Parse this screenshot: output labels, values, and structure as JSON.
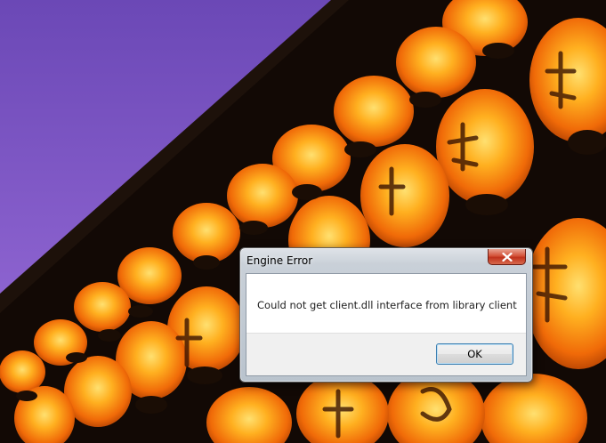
{
  "wallpaper": {
    "icon": "paper-lanterns-wallpaper",
    "colors": {
      "sky": "#8a5cd0",
      "lantern": "#f07a10",
      "lantern_glow": "#ffd24a",
      "beam": "#140c08"
    }
  },
  "dialog": {
    "title": "Engine Error",
    "close_icon": "close-icon",
    "message": "Could not get client.dll interface from library client",
    "ok_label": "OK",
    "colors": {
      "close_button": "#c7381f",
      "ok_border": "#3c7fb1"
    }
  }
}
